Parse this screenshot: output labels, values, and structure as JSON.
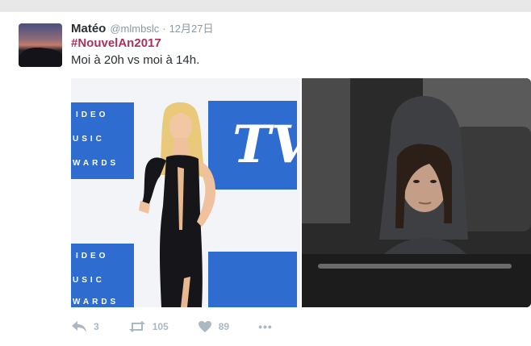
{
  "tweet": {
    "author_name": "Matéo",
    "handle": "@mlmbslc",
    "separator": "·",
    "date": "12月27日",
    "hashtag": "#NouvelAn2017",
    "text": "Moi à 20h vs moi à 14h."
  },
  "media": {
    "left_photo": {
      "backdrop_texts": [
        "IDEO",
        "USIC",
        "WARDS",
        "IDEO",
        "USIC",
        "WARDS"
      ],
      "logo_text": "TV"
    },
    "right_photo": {}
  },
  "actions": {
    "reply_count": "3",
    "retweet_count": "105",
    "like_count": "89",
    "more_label": "•••"
  },
  "colors": {
    "hashtag": "#a8325e",
    "muted": "#8899a6",
    "icon": "#aab8c2",
    "backdrop_blue": "#2f6ccf"
  }
}
